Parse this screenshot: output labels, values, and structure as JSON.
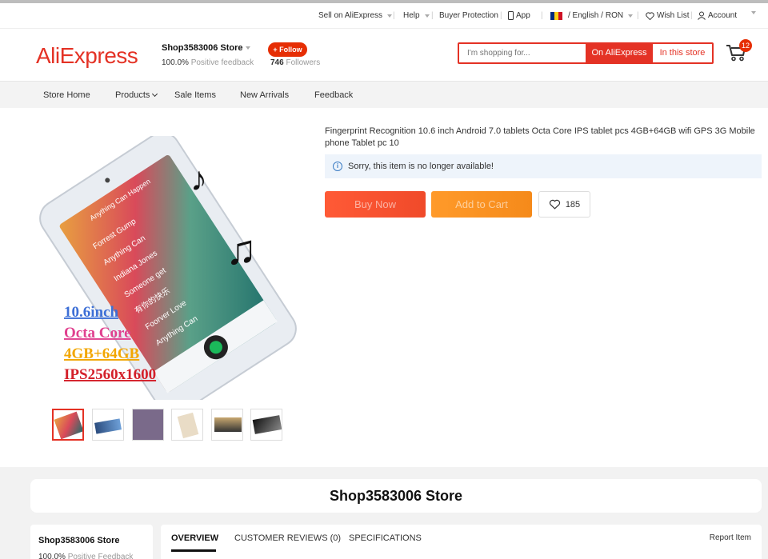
{
  "topbar": {
    "sell": "Sell on AliExpress",
    "help": "Help",
    "buyer_protection": "Buyer Protection",
    "app": "App",
    "language": "/ English /",
    "currency": "RON",
    "wishlist": "Wish List",
    "account": "Account"
  },
  "header": {
    "logo": "AliExpress",
    "store_name": "Shop3583006 Store",
    "feedback_value": "100.0%",
    "feedback_label": "Positive feedback",
    "follow": "+ Follow",
    "followers_count": "746",
    "followers_label": "Followers",
    "search_placeholder": "I'm shopping for...",
    "search_on_site": "On AliExpress",
    "search_in_store": "In this store",
    "cart_count": "12"
  },
  "nav": {
    "items": [
      "Store Home",
      "Products",
      "Sale Items",
      "New Arrivals",
      "Feedback"
    ]
  },
  "product": {
    "title": "Fingerprint Recognition 10.6 inch Android 7.0 tablets Octa Core IPS tablet pcs 4GB+64GB wifi GPS 3G Mobile phone Tablet pc 10",
    "notice": "Sorry, this item is no longer available!",
    "buy_now": "Buy Now",
    "add_to_cart": "Add to Cart",
    "wish_count": "185",
    "image_text": {
      "line1": "10.6inch",
      "line2": "Octa Core",
      "line3": "4GB+64GB",
      "line4": "IPS2560x1600"
    },
    "image_colors": {
      "line1": "#3d6fd6",
      "line2": "#e0408f",
      "line3": "#f2a600",
      "line4": "#d4202a"
    },
    "screen_text": {
      "header": "Anything Can Happen",
      "songs": [
        "Forrest Gump",
        "Anything Can",
        "Indiana Jones",
        "Someone get",
        "有你的快乐",
        "Foorver Love",
        "Anything Can"
      ]
    }
  },
  "store_section": {
    "banner": "Shop3583006 Store",
    "side_name": "Shop3583006 Store",
    "side_feedback_value": "100.0%",
    "side_feedback_label": "Positive Feedback",
    "tabs": [
      "OVERVIEW",
      "CUSTOMER REVIEWS (0)",
      "SPECIFICATIONS"
    ],
    "report": "Report Item"
  },
  "colors": {
    "brand": "#e43225",
    "buy": "#ff5a36",
    "cart": "#ff9a2a",
    "notice_bg": "#eef4fb"
  }
}
